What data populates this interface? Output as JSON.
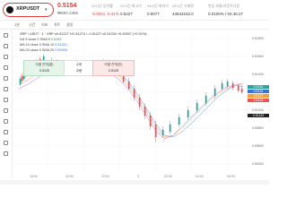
{
  "header": {
    "symbol": "XRPUSDT",
    "price": "0.5154",
    "price_usd": "₩694.2366",
    "stats": [
      {
        "label": "24시간 등락률",
        "value": "-0.0021 -0.41%"
      },
      {
        "label": "24시간 최고가",
        "value": "0.5227"
      },
      {
        "label": "24시간 최저가",
        "value": "0.5077"
      },
      {
        "label": "24시간 거래량",
        "value": "43643152.0"
      },
      {
        "label": "펀딩 비율/카운트다운",
        "value": "0.0100% / 04:46:27"
      }
    ]
  },
  "toolbar": {
    "interval": "1분",
    "items": [
      "시간",
      "지표",
      "차트",
      "설정"
    ]
  },
  "legend": {
    "title": "XRP / USDT · 1 · XRP",
    "ohlc": "o0.51227  ㅂ0.51274  ㄴ0.51227  c0.51234  +0.00007 (+0.01%)",
    "rows": [
      {
        "label": "Vol 5 close 0 SMA 9",
        "value": "0.5153"
      },
      {
        "label": "MA 10 close 0 SMA 10",
        "value": "0.51321"
      },
      {
        "label": "MA 20 close 0 SMA 20",
        "value": "0.50993"
      }
    ]
  },
  "tooltip": {
    "left_title": "미결 잔액(롱)",
    "left_value": "0.5125",
    "mid_title": "수량",
    "mid_value": "수량",
    "right_title": "미결 잔액(숏)",
    "right_value": "0.5125"
  },
  "yaxis": [
    "0.51800",
    "0.51600",
    "0.51400",
    "0.51200",
    "0.51000",
    "0.50800",
    "0.50600",
    "0.50400"
  ],
  "pricebox": [
    "0.5154",
    "0.5134",
    "0.5127",
    "0.5123",
    "0.51149"
  ],
  "xaxis": [
    "18:00",
    "20:00",
    "22:00",
    "3",
    "02:00",
    "04:00",
    "06:00"
  ],
  "colors": {
    "up": "#26a69a",
    "down": "#ef5350",
    "accent": "#e23b3b"
  }
}
